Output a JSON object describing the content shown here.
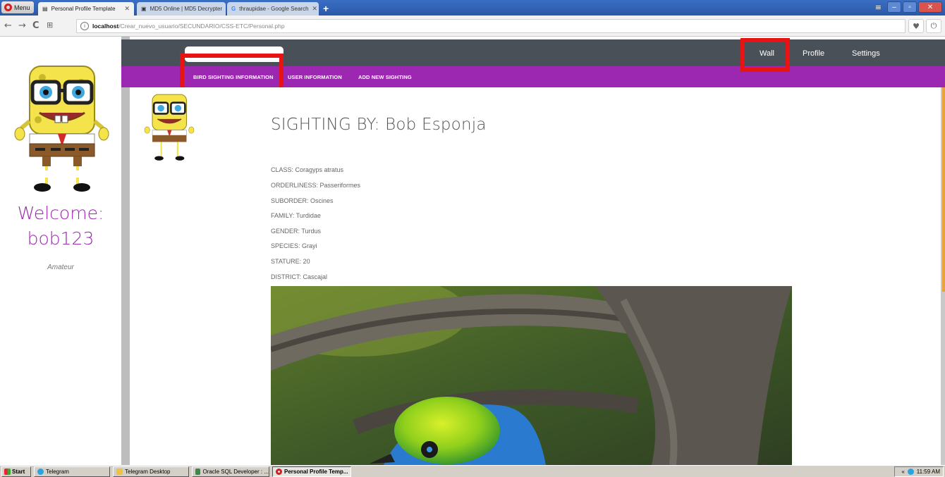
{
  "browser": {
    "menu_label": "Menu",
    "tabs": [
      {
        "label": "Personal Profile Template",
        "active": true
      },
      {
        "label": "MD5 Online | MD5 Decrypter",
        "active": false
      },
      {
        "label": "thraupidae - Google Search",
        "active": false
      }
    ],
    "new_tab": "+",
    "url_host": "localhost",
    "url_path": "/Crear_nuevo_usuario/SECUNDARIO/CSS-ETC/Personal.php",
    "window_controls": [
      "minimize",
      "restore",
      "close"
    ]
  },
  "sidebar": {
    "avatar": "spongebob-avatar",
    "welcome": "Welcome:",
    "username": "bob123",
    "rank": "Amateur"
  },
  "topnav": {
    "items": [
      "Wall",
      "Profile",
      "Settings"
    ]
  },
  "subnav": {
    "items": [
      "BIRD SIGHTING INFORMATION",
      "USER INFORMATION",
      "ADD NEW SIGHTING"
    ]
  },
  "sighting": {
    "title": "SIGHTING BY: Bob Esponja",
    "facts": [
      "CLASS: Coragyps atratus",
      "ORDERLINESS: Passeriformes",
      "SUBORDER: Oscines",
      "FAMILY: Turdidae",
      "GENDER: Turdus",
      "SPECIES: Grayi",
      "STATURE: 20",
      "DISTRICT: Cascajal"
    ],
    "photo": "bird-photo"
  },
  "taskbar": {
    "start": "Start",
    "items": [
      {
        "label": "Telegram",
        "active": false
      },
      {
        "label": "Telegram Desktop",
        "active": false
      },
      {
        "label": "Oracle SQL Developer : ...",
        "active": false
      },
      {
        "label": "Personal Profile Temp...",
        "active": true
      }
    ],
    "clock": "11:59 AM"
  },
  "colors": {
    "accent": "#9c27b0",
    "topbar": "#4a5057",
    "highlight_box": "#e81313"
  }
}
